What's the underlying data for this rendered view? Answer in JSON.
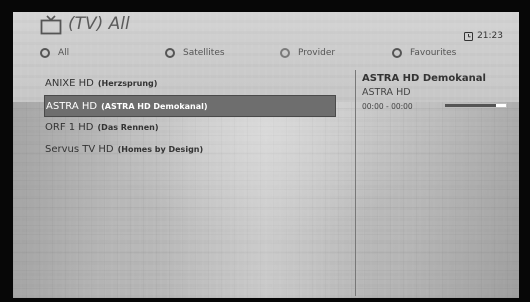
{
  "header": {
    "icon": "tv-icon",
    "title": "(TV) All",
    "clock_icon": "clock-icon",
    "clock": "21:23"
  },
  "filters": [
    {
      "label": "All",
      "selected": true
    },
    {
      "label": "Satellites",
      "selected": false
    },
    {
      "label": "Provider",
      "selected": false
    },
    {
      "label": "Favourites",
      "selected": false
    }
  ],
  "channels": [
    {
      "name": "ANIXE HD",
      "program": "(Herzsprung)"
    },
    {
      "name": "ASTRA HD",
      "program": "(ASTRA HD Demokanal)"
    },
    {
      "name": "ORF 1 HD",
      "program": "(Das Rennen)"
    },
    {
      "name": "Servus TV HD",
      "program": "(Homes by Design)"
    }
  ],
  "selected_channel_index": 1,
  "detail": {
    "program_title": "ASTRA HD Demokanal",
    "channel": "ASTRA HD",
    "time": "00:00  - 00:00",
    "progress": 0.83
  },
  "colors": {
    "selected_row": "#6e6e6e",
    "text": "#333333",
    "progress_fill": "#555555"
  }
}
